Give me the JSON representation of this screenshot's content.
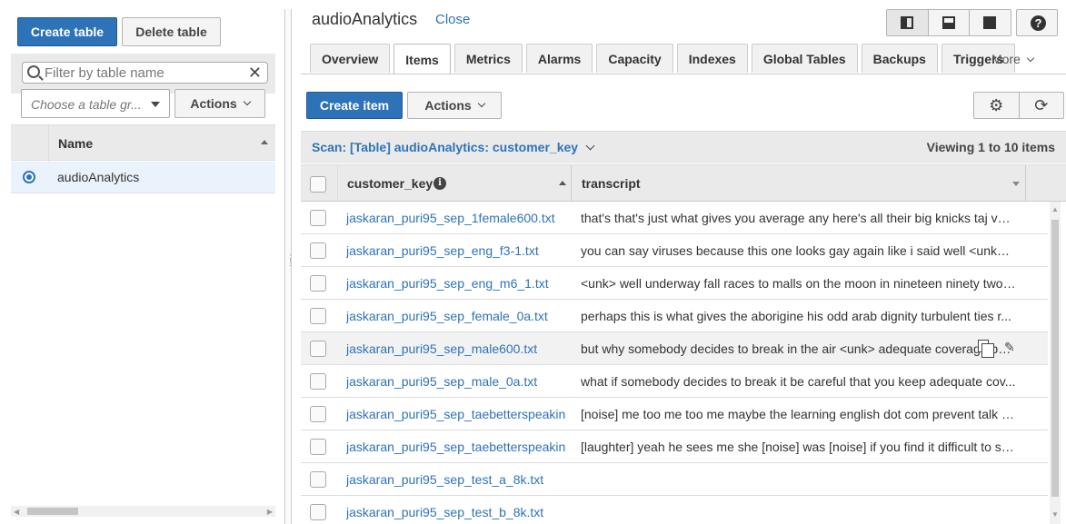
{
  "left_panel": {
    "create_table_label": "Create table",
    "delete_table_label": "Delete table",
    "filter_placeholder": "Filter by table name",
    "group_placeholder": "Choose a table gr...",
    "actions_label": "Actions",
    "table_header": "Name",
    "tables": [
      {
        "name": "audioAnalytics",
        "selected": true
      }
    ]
  },
  "main": {
    "table_title": "audioAnalytics",
    "close_label": "Close",
    "tabs": [
      {
        "label": "Overview"
      },
      {
        "label": "Items",
        "active": true
      },
      {
        "label": "Metrics"
      },
      {
        "label": "Alarms"
      },
      {
        "label": "Capacity"
      },
      {
        "label": "Indexes"
      },
      {
        "label": "Global Tables"
      },
      {
        "label": "Backups"
      },
      {
        "label": "Triggers"
      }
    ],
    "more_label": "More",
    "create_item_label": "Create item",
    "actions_label": "Actions",
    "scan_label": "Scan: [Table] audioAnalytics: customer_key",
    "viewing_label": "Viewing 1 to 10 items",
    "columns": {
      "key": "customer_key",
      "transcript": "transcript"
    },
    "items": [
      {
        "customer_key": "jaskaran_puri95_sep_1female600.txt",
        "transcript": "that's that's just what gives you average any here's all their big knicks taj ver..."
      },
      {
        "customer_key": "jaskaran_puri95_sep_eng_f3-1.txt",
        "transcript": "you can say viruses because this one looks gay again like i said well <unk> i ..."
      },
      {
        "customer_key": "jaskaran_puri95_sep_eng_m6_1.txt",
        "transcript": "<unk> well underway fall races to malls on the moon in nineteen ninety two ..."
      },
      {
        "customer_key": "jaskaran_puri95_sep_female_0a.txt",
        "transcript": "perhaps this is what gives the aborigine his odd arab dignity turbulent ties r..."
      },
      {
        "customer_key": "jaskaran_puri95_sep_male600.txt",
        "transcript": "but why somebody decides to break in the air <unk> adequate coverage but ..."
      },
      {
        "customer_key": "jaskaran_puri95_sep_male_0a.txt",
        "transcript": "what if somebody decides to break it be careful that you keep adequate cov..."
      },
      {
        "customer_key": "jaskaran_puri95_sep_taebetterspeakin",
        "transcript": "[noise] me too me too me maybe the learning english dot com prevent talk a..."
      },
      {
        "customer_key": "jaskaran_puri95_sep_taebetterspeakin",
        "transcript": "[laughter] yeah he sees me she [noise] was [noise] if you find it difficult to sp..."
      },
      {
        "customer_key": "jaskaran_puri95_sep_test_a_8k.txt",
        "transcript": ""
      },
      {
        "customer_key": "jaskaran_puri95_sep_test_b_8k.txt",
        "transcript": ""
      }
    ]
  },
  "colors": {
    "primary": "#2e73b8",
    "link": "#2e73b8",
    "header_bg": "#eaeaea"
  }
}
